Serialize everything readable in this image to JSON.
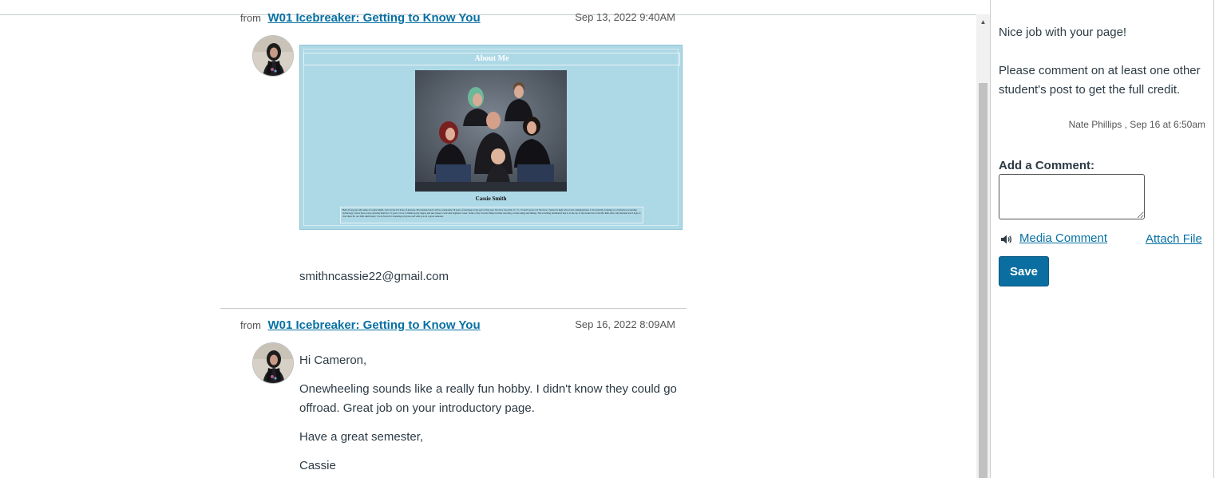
{
  "entries": [
    {
      "from_label": "from",
      "topic": "W01 Icebreaker: Getting to Know You",
      "date": "Sep 13, 2022 9:40AM",
      "about_card": {
        "title": "About Me",
        "name": "Cassie Smith",
        "bio": "Hello Everyone, My name is Cassie Smith, I live in the US State of Arizona. My husband and I will be celebrating 18 years of marriage at the end of this year. We have four kids 17, 15, 13 and 9 years old. We have a Senior in high school and a kindergartner. I am currently working on a bachelors in nursing technology. I have been a stay-at-home mom for 15 years. I love to finish up my degree and just joined a welcome beginner career. Some of my favorite things include traveling, scrapbooking and hiking. The travelling destination that is at the top of my bucket list is Pacific Rim, Peru. My husband and I hope to visit there for our 20th anniversary. I look forward to meeting everyone and wish you all a great semester."
      },
      "email": "smithncassie22@gmail.com"
    },
    {
      "from_label": "from",
      "topic": "W01 Icebreaker: Getting to Know You",
      "date": "Sep 16, 2022 8:09AM",
      "paragraphs": [
        "Hi Cameron,",
        "Onewheeling sounds like a really fun hobby. I didn't know they could go offroad. Great job on your introductory page.",
        "Have a great semester,",
        "Cassie"
      ]
    }
  ],
  "comment_panel": {
    "comment_paragraphs": [
      "Nice job with your page!",
      "Please comment on at least one other student's post to get the full credit."
    ],
    "comment_author": "Nate Phillips , Sep 16 at 6:50am",
    "add_comment_label": "Add a Comment:",
    "comment_placeholder": "",
    "media_comment_label": "Media Comment",
    "attach_file_label": "Attach File",
    "save_label": "Save"
  },
  "colors": {
    "link": "#0770a3",
    "primary_button": "#0b6ea0",
    "about_card_bg": "#add8e6"
  },
  "icons": [
    "speaker-icon",
    "scroll-up-arrow-icon"
  ]
}
